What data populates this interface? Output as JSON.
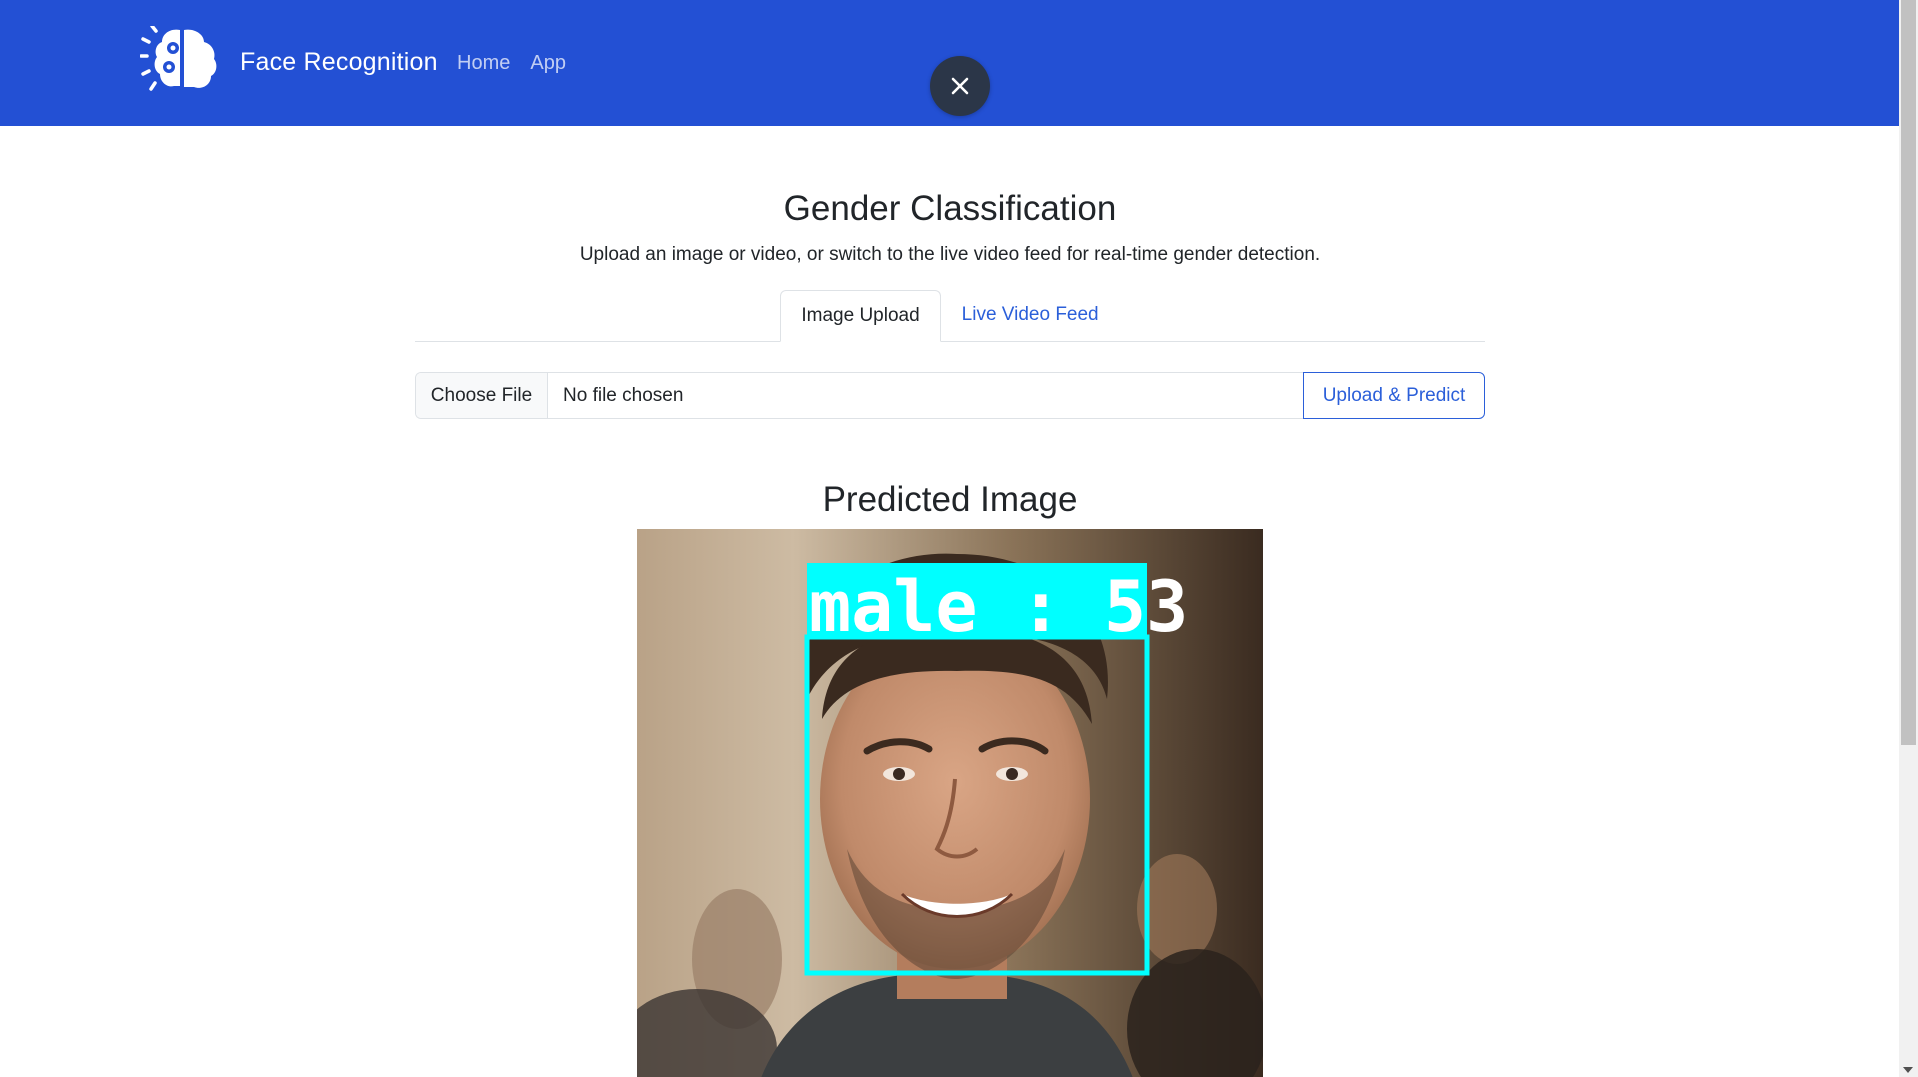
{
  "navbar": {
    "brand_text": "Face Recognition",
    "links": [
      {
        "label": "Home"
      },
      {
        "label": "App"
      }
    ],
    "logo_icon": "brain-gears-icon",
    "close_icon": "close-icon",
    "background_color": "#2350d4"
  },
  "main": {
    "title": "Gender Classification",
    "subtitle": "Upload an image or video, or switch to the live video feed for real-time gender detection.",
    "tabs": [
      {
        "label": "Image Upload",
        "active": true
      },
      {
        "label": "Live Video Feed",
        "active": false
      }
    ],
    "upload": {
      "choose_label": "Choose File",
      "file_name": "No file chosen",
      "submit_label": "Upload & Predict"
    },
    "result": {
      "title": "Predicted Image",
      "prediction_label": "male : 53",
      "box_color": "#00ffff"
    }
  },
  "colors": {
    "accent": "#2b5fd9",
    "text": "#212529",
    "close_button": "#2b3648"
  }
}
